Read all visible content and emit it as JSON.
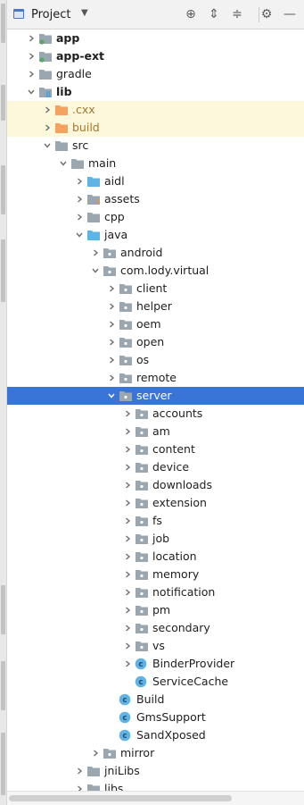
{
  "header": {
    "title": "Project",
    "buttons": [
      {
        "name": "locate-icon",
        "glyph": "⊕"
      },
      {
        "name": "expand-all-icon",
        "glyph": "⇕"
      },
      {
        "name": "collapse-all-icon",
        "glyph": "≑"
      },
      {
        "name": "gear-icon",
        "glyph": "⚙"
      },
      {
        "name": "hide-icon",
        "glyph": "—"
      }
    ]
  },
  "colors": {
    "folder": "#9aa7b0",
    "folder_blue": "#5fb4e5",
    "folder_orange": "#f3a35f",
    "module_dot": "#59a869",
    "selection": "#3875d7",
    "excluded_bg": "#fdf7dc",
    "class_icon": "#5fb4e5"
  },
  "tree": [
    {
      "label": "app",
      "depth": 0,
      "arrow": "right",
      "icon": "module",
      "bold": true
    },
    {
      "label": "app-ext",
      "depth": 0,
      "arrow": "right",
      "icon": "module",
      "bold": true
    },
    {
      "label": "gradle",
      "depth": 0,
      "arrow": "right",
      "icon": "folder"
    },
    {
      "label": "lib",
      "depth": 0,
      "arrow": "down",
      "icon": "lib-module",
      "bold": true
    },
    {
      "label": ".cxx",
      "depth": 1,
      "arrow": "right",
      "icon": "folder-orange",
      "excluded": true
    },
    {
      "label": "build",
      "depth": 1,
      "arrow": "right",
      "icon": "folder-orange",
      "excluded": true
    },
    {
      "label": "src",
      "depth": 1,
      "arrow": "down",
      "icon": "folder"
    },
    {
      "label": "main",
      "depth": 2,
      "arrow": "down",
      "icon": "folder"
    },
    {
      "label": "aidl",
      "depth": 3,
      "arrow": "right",
      "icon": "folder-blue"
    },
    {
      "label": "assets",
      "depth": 3,
      "arrow": "right",
      "icon": "folder-assets"
    },
    {
      "label": "cpp",
      "depth": 3,
      "arrow": "right",
      "icon": "folder"
    },
    {
      "label": "java",
      "depth": 3,
      "arrow": "down",
      "icon": "folder-blue"
    },
    {
      "label": "android",
      "depth": 4,
      "arrow": "right",
      "icon": "package"
    },
    {
      "label": "com.lody.virtual",
      "depth": 4,
      "arrow": "down",
      "icon": "package"
    },
    {
      "label": "client",
      "depth": 5,
      "arrow": "right",
      "icon": "package"
    },
    {
      "label": "helper",
      "depth": 5,
      "arrow": "right",
      "icon": "package"
    },
    {
      "label": "oem",
      "depth": 5,
      "arrow": "right",
      "icon": "package"
    },
    {
      "label": "open",
      "depth": 5,
      "arrow": "right",
      "icon": "package"
    },
    {
      "label": "os",
      "depth": 5,
      "arrow": "right",
      "icon": "package"
    },
    {
      "label": "remote",
      "depth": 5,
      "arrow": "right",
      "icon": "package"
    },
    {
      "label": "server",
      "depth": 5,
      "arrow": "down",
      "icon": "package",
      "selected": true
    },
    {
      "label": "accounts",
      "depth": 6,
      "arrow": "right",
      "icon": "package"
    },
    {
      "label": "am",
      "depth": 6,
      "arrow": "right",
      "icon": "package"
    },
    {
      "label": "content",
      "depth": 6,
      "arrow": "right",
      "icon": "package"
    },
    {
      "label": "device",
      "depth": 6,
      "arrow": "right",
      "icon": "package"
    },
    {
      "label": "downloads",
      "depth": 6,
      "arrow": "right",
      "icon": "package"
    },
    {
      "label": "extension",
      "depth": 6,
      "arrow": "right",
      "icon": "package"
    },
    {
      "label": "fs",
      "depth": 6,
      "arrow": "right",
      "icon": "package"
    },
    {
      "label": "job",
      "depth": 6,
      "arrow": "right",
      "icon": "package"
    },
    {
      "label": "location",
      "depth": 6,
      "arrow": "right",
      "icon": "package"
    },
    {
      "label": "memory",
      "depth": 6,
      "arrow": "right",
      "icon": "package"
    },
    {
      "label": "notification",
      "depth": 6,
      "arrow": "right",
      "icon": "package"
    },
    {
      "label": "pm",
      "depth": 6,
      "arrow": "right",
      "icon": "package"
    },
    {
      "label": "secondary",
      "depth": 6,
      "arrow": "right",
      "icon": "package"
    },
    {
      "label": "vs",
      "depth": 6,
      "arrow": "right",
      "icon": "package"
    },
    {
      "label": "BinderProvider",
      "depth": 6,
      "arrow": "right",
      "icon": "class"
    },
    {
      "label": "ServiceCache",
      "depth": 6,
      "arrow": "none",
      "icon": "class"
    },
    {
      "label": "Build",
      "depth": 5,
      "arrow": "none",
      "icon": "class"
    },
    {
      "label": "GmsSupport",
      "depth": 5,
      "arrow": "none",
      "icon": "class"
    },
    {
      "label": "SandXposed",
      "depth": 5,
      "arrow": "none",
      "icon": "class"
    },
    {
      "label": "mirror",
      "depth": 4,
      "arrow": "right",
      "icon": "package"
    },
    {
      "label": "jniLibs",
      "depth": 3,
      "arrow": "right",
      "icon": "folder"
    },
    {
      "label": "libs",
      "depth": 3,
      "arrow": "right",
      "icon": "folder"
    },
    {
      "label": "...",
      "depth": 3,
      "arrow": "right",
      "icon": "folder"
    }
  ]
}
